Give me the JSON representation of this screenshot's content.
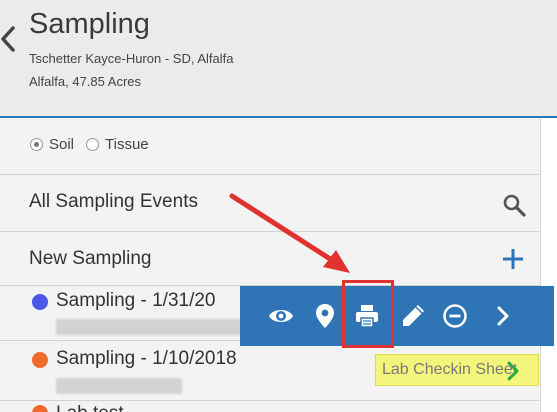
{
  "header": {
    "title": "Sampling",
    "subtitle_line1": "Tschetter Kayce-Huron - SD, Alfalfa",
    "subtitle_line2": "Alfalfa, 47.85 Acres"
  },
  "sample_type": {
    "options": [
      "Soil",
      "Tissue"
    ],
    "selected": "Soil"
  },
  "menu": {
    "all_events_label": "All Sampling Events",
    "new_sampling_label": "New Sampling"
  },
  "events": [
    {
      "label": "Sampling - 1/31/20",
      "dot_color": "#4a57e8"
    },
    {
      "label": "Sampling - 1/10/2018",
      "dot_color": "#f06a2b"
    },
    {
      "label": "Lab test",
      "dot_color": "#f06a2b"
    }
  ],
  "action_bar": {
    "icons": [
      "eye-icon",
      "map-pin-icon",
      "print-icon",
      "pencil-icon",
      "minus-circle-icon",
      "chevron-right-icon"
    ]
  },
  "tooltip": {
    "text": "Lab Checkin Sheet"
  },
  "colors": {
    "accent_blue": "#2f75b5",
    "annotation_red": "#e0322f",
    "tooltip_yellow": "#f3f67a",
    "chevron_green": "#27a844"
  }
}
